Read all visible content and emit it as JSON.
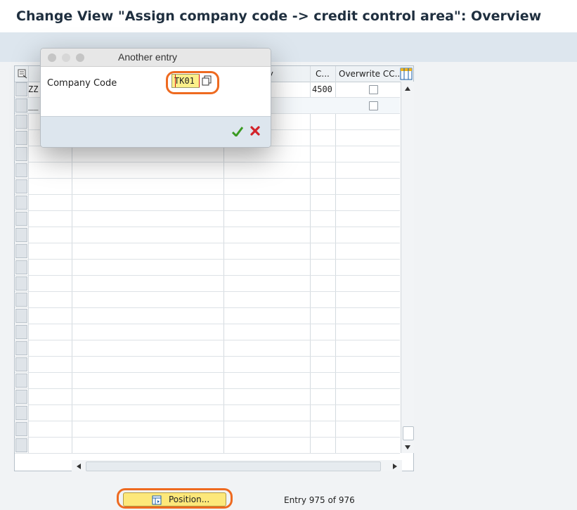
{
  "title": "Change View \"Assign company code -> credit control area\": Overview",
  "table": {
    "columns": {
      "partial_header": "ty",
      "c_header": "C...",
      "overwrite_header": "Overwrite CC..."
    },
    "rows": [
      {
        "company": "ZZ",
        "cca": "4500",
        "overwrite": false
      },
      {
        "company": "__",
        "cca": "",
        "overwrite": false
      }
    ],
    "empty_rows": 21
  },
  "dialog": {
    "title": "Another entry",
    "field_label": "Company Code",
    "field_value": "TK01",
    "confirm_icon": "checkmark-icon",
    "cancel_icon": "cancel-x-icon"
  },
  "footer": {
    "position_button": "Position...",
    "entry_status": "Entry 975 of 976"
  },
  "colors": {
    "highlight_ring": "#ee6a20",
    "input_bg": "#fbf08a",
    "toolbar_bg": "#dde6ee"
  }
}
